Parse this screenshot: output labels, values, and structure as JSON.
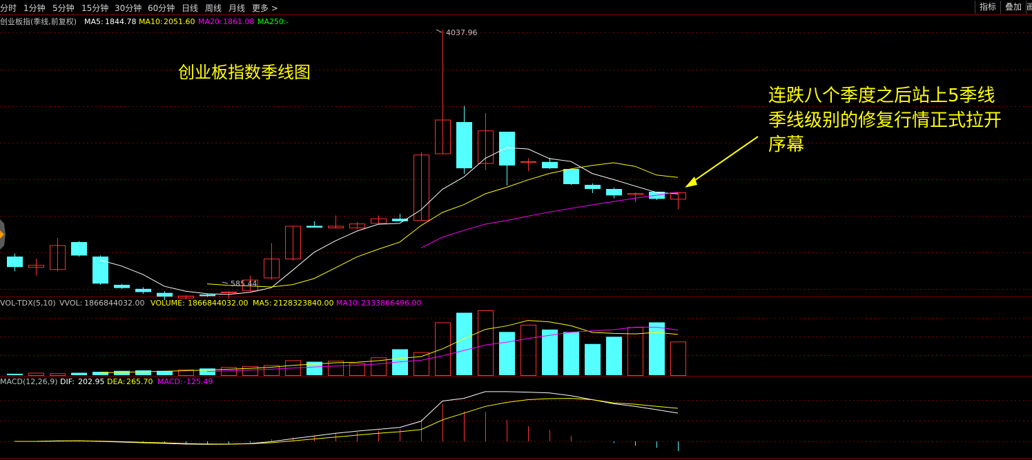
{
  "toolbar": {
    "timeframes": [
      "分时",
      "1分钟",
      "5分钟",
      "15分钟",
      "30分钟",
      "60分钟",
      "日线",
      "周线",
      "月线",
      "更多 >"
    ],
    "right_buttons": [
      "指标",
      "叠加",
      "画"
    ]
  },
  "colors": {
    "up": "#ff3232",
    "down": "#54ffff",
    "ma5": "#ffffff",
    "ma10": "#ffff00",
    "ma20": "#ff00ff",
    "ma250": "#00ff00",
    "grid": "#800000",
    "annotation": "#ffff00"
  },
  "main": {
    "title": "创业板指(季线,前复权)",
    "ma5": {
      "label": "MA5:",
      "value": "1844.78"
    },
    "ma10": {
      "label": "MA10:",
      "value": "2051.60"
    },
    "ma20": {
      "label": "MA20:",
      "value": "1861.08"
    },
    "ma250": {
      "label": "MA250:",
      "value": "-"
    },
    "high_label": "4037.96",
    "low_label": "585.44",
    "chart_title": "创业板指数季线图",
    "annotation": [
      "连跌八个季度之后站上5季线",
      "季线级别的修复行情正式拉开",
      "序幕"
    ]
  },
  "volume": {
    "indicator": "VOL-TDX(5,10)",
    "vvol": {
      "label": "VVOL:",
      "value": "1866844032.00"
    },
    "volume": {
      "label": "VOLUME:",
      "value": "1866844032.00"
    },
    "ma5": {
      "label": "MA5:",
      "value": "2128323840.00"
    },
    "ma10": {
      "label": "MA10:",
      "value": "2333866496.00"
    }
  },
  "macd": {
    "indicator": "MACD(12,26,9)",
    "dif": {
      "label": "DIF:",
      "value": "202.95"
    },
    "dea": {
      "label": "DEA:",
      "value": "265.70"
    },
    "macd": {
      "label": "MACD:",
      "value": "-125.49"
    }
  },
  "chart_data": {
    "type": "candlestick",
    "candles": [
      {
        "o": 720,
        "h": 750,
        "l": 640,
        "c": 660
      },
      {
        "o": 660,
        "h": 700,
        "l": 620,
        "c": 670
      },
      {
        "o": 650,
        "h": 900,
        "l": 640,
        "c": 830
      },
      {
        "o": 860,
        "h": 870,
        "l": 720,
        "c": 730
      },
      {
        "o": 720,
        "h": 730,
        "l": 560,
        "c": 575
      },
      {
        "o": 560,
        "h": 570,
        "l": 510,
        "c": 520
      },
      {
        "o": 510,
        "h": 530,
        "l": 450,
        "c": 470
      },
      {
        "o": 460,
        "h": 480,
        "l": 370,
        "c": 415
      },
      {
        "o": 400,
        "h": 430,
        "l": 380,
        "c": 425
      },
      {
        "o": 440,
        "h": 450,
        "l": 410,
        "c": 420
      },
      {
        "o": 475,
        "h": 480,
        "l": 390,
        "c": 475
      },
      {
        "o": 490,
        "h": 620,
        "l": 480,
        "c": 600
      },
      {
        "o": 610,
        "h": 850,
        "l": 600,
        "c": 700
      },
      {
        "o": 700,
        "h": 1020,
        "l": 690,
        "c": 1030
      },
      {
        "o": 1030,
        "h": 1110,
        "l": 1000,
        "c": 1000
      },
      {
        "o": 1000,
        "h": 1210,
        "l": 990,
        "c": 1030
      },
      {
        "o": 1000,
        "h": 1100,
        "l": 990,
        "c": 1070
      },
      {
        "o": 1080,
        "h": 1210,
        "l": 1070,
        "c": 1160
      },
      {
        "o": 1155,
        "h": 1240,
        "l": 1110,
        "c": 1110
      },
      {
        "o": 1130,
        "h": 2220,
        "l": 1120,
        "c": 2180
      },
      {
        "o": 2200,
        "h": 4037.96,
        "l": 2190,
        "c": 2760
      },
      {
        "o": 2720,
        "h": 2960,
        "l": 1880,
        "c": 1960
      },
      {
        "o": 2040,
        "h": 2860,
        "l": 1930,
        "c": 2580
      },
      {
        "o": 2560,
        "h": 2560,
        "l": 1710,
        "c": 2000
      },
      {
        "o": 2060,
        "h": 2120,
        "l": 1920,
        "c": 2070
      },
      {
        "o": 2060,
        "h": 2130,
        "l": 1950,
        "c": 1960
      },
      {
        "o": 1950,
        "h": 1950,
        "l": 1720,
        "c": 1730
      },
      {
        "o": 1720,
        "h": 1740,
        "l": 1600,
        "c": 1660
      },
      {
        "o": 1660,
        "h": 1680,
        "l": 1510,
        "c": 1560
      },
      {
        "o": 1580,
        "h": 1610,
        "l": 1440,
        "c": 1600
      },
      {
        "o": 1620,
        "h": 1620,
        "l": 1480,
        "c": 1500
      },
      {
        "o": 1500,
        "h": 1610,
        "l": 1320,
        "c": 1610
      }
    ],
    "volume": [
      0.03,
      0.05,
      0.04,
      0.05,
      0.07,
      0.09,
      0.1,
      0.09,
      0.12,
      0.14,
      0.17,
      0.19,
      0.21,
      0.31,
      0.28,
      0.3,
      0.25,
      0.37,
      0.54,
      0.48,
      1.1,
      1.3,
      1.35,
      0.9,
      1.05,
      0.95,
      0.9,
      0.65,
      0.8,
      1.0,
      1.1,
      0.7
    ],
    "macd_dif": [
      0,
      0,
      0.2,
      0.2,
      0,
      -0.25,
      -0.5,
      -0.75,
      -1,
      -1.1,
      -1.05,
      -0.8,
      -0.1,
      1,
      2,
      3,
      3.8,
      4.5,
      5.2,
      7.5,
      15,
      16,
      18.5,
      18.5,
      18.3,
      18,
      17,
      15.5,
      14,
      13,
      11.8,
      10.5
    ],
    "macd_dea": [
      0,
      0,
      0.1,
      0.2,
      0.1,
      -0.1,
      -0.35,
      -0.55,
      -0.8,
      -0.95,
      -1.0,
      -0.9,
      -0.5,
      0.2,
      0.9,
      1.6,
      2.3,
      3.0,
      3.6,
      4.4,
      8,
      10.5,
      13,
      14.5,
      15.5,
      15.9,
      16,
      15.5,
      14.3,
      13.8,
      13,
      12.3
    ],
    "macd_bars": [
      0,
      0,
      0,
      0,
      0,
      -0.3,
      -0.6,
      -0.9,
      -1.1,
      -1.1,
      -0.9,
      -0.4,
      0.8,
      1.5,
      2.2,
      3.1,
      3.4,
      3.9,
      4.6,
      8.1,
      14,
      11.1,
      11,
      8,
      5.6,
      4.2,
      2,
      0,
      -0.6,
      -1.6,
      -2.4,
      -3.6
    ],
    "ylim": [
      500,
      4200
    ]
  }
}
